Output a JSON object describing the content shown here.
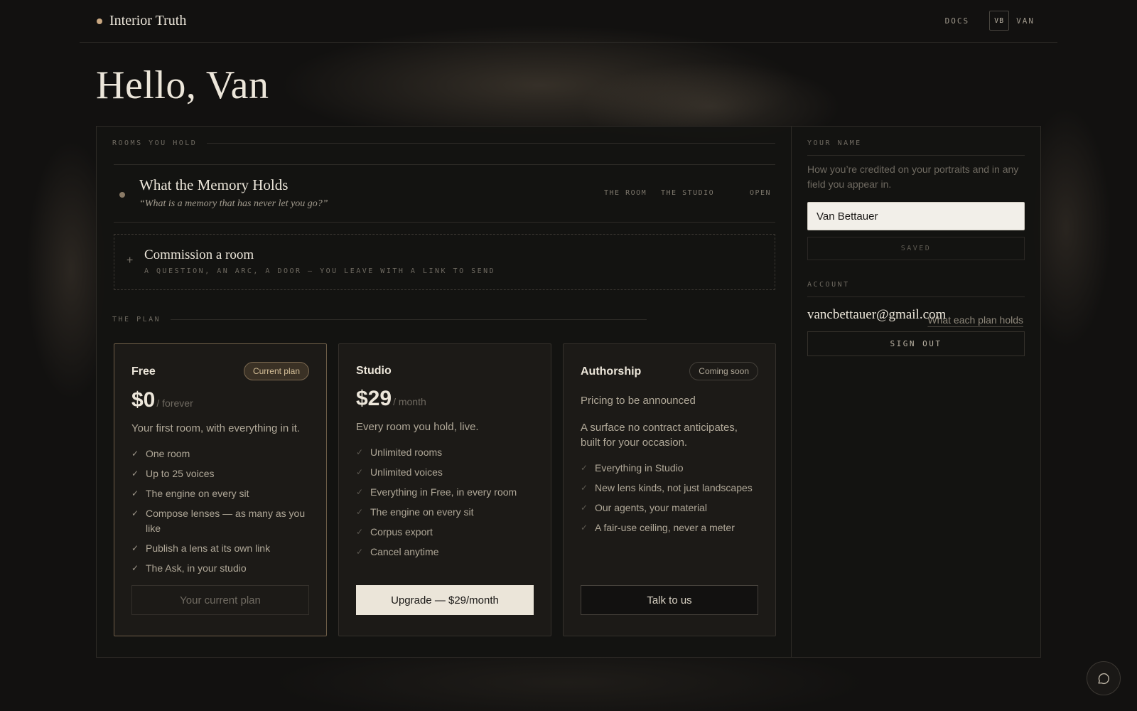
{
  "header": {
    "brand": "Interior Truth",
    "docs": "DOCS",
    "avatar_initials": "VB",
    "user_label": "VAN"
  },
  "greeting": "Hello, Van",
  "rooms": {
    "section_label": "ROOMS YOU HOLD",
    "items": [
      {
        "title": "What the Memory Holds",
        "quote": "“What is a memory that has never let you go?”",
        "meta": [
          "THE ROOM",
          "THE STUDIO",
          "OPEN"
        ]
      }
    ],
    "commission": {
      "plus": "+",
      "title": "Commission a room",
      "subtitle": "A QUESTION, AN ARC, A DOOR — YOU LEAVE WITH A LINK TO SEND"
    }
  },
  "plans": {
    "section_label": "THE PLAN",
    "link": "What each plan holds",
    "cards": [
      {
        "name": "Free",
        "badge": "Current plan",
        "price": "$0",
        "period": "/ forever",
        "description": "Your first room, with everything in it.",
        "features": [
          "One room",
          "Up to 25 voices",
          "The engine on every sit",
          "Compose lenses — as many as you like",
          "Publish a lens at its own link",
          "The Ask, in your studio"
        ],
        "button": "Your current plan"
      },
      {
        "name": "Studio",
        "price": "$29",
        "period": "/ month",
        "description": "Every room you hold, live.",
        "features": [
          "Unlimited rooms",
          "Unlimited voices",
          "Everything in Free, in every room",
          "The engine on every sit",
          "Corpus export",
          "Cancel anytime"
        ],
        "button": "Upgrade — $29/month"
      },
      {
        "name": "Authorship",
        "badge": "Coming soon",
        "price_note": "Pricing to be announced",
        "description": "A surface no contract anticipates, built for your occasion.",
        "features": [
          "Everything in Studio",
          "New lens kinds, not just landscapes",
          "Our agents, your material",
          "A fair-use ceiling, never a meter"
        ],
        "button": "Talk to us"
      }
    ],
    "check_glyph": "✓"
  },
  "profile": {
    "name_label": "YOUR NAME",
    "name_help": "How you’re credited on your portraits and in any field you appear in.",
    "name_value": "Van Bettauer",
    "saved": "SAVED",
    "account_label": "ACCOUNT",
    "email": "vancbettauer@gmail.com",
    "sign_out": "SIGN OUT"
  },
  "icons": {
    "chat": "chat-bubble-icon"
  },
  "colors": {
    "background": "#121110",
    "accent_gold": "#c9a882",
    "text_primary": "#ece6da",
    "primary_button": "#ebe5d9"
  }
}
